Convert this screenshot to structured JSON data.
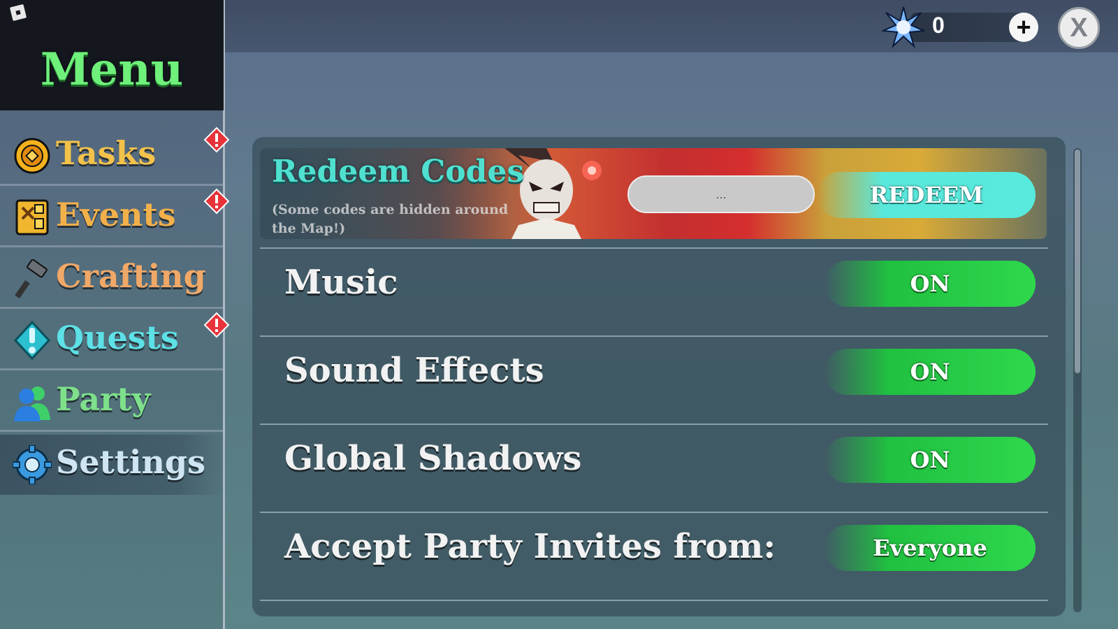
{
  "menu": {
    "title": "Menu",
    "items": [
      {
        "label": "Tasks",
        "color": "#f2c24a",
        "icon": "coin-icon",
        "alert": true
      },
      {
        "label": "Events",
        "color": "#f2b04a",
        "icon": "scroll-icon",
        "alert": true
      },
      {
        "label": "Crafting",
        "color": "#f0a868",
        "icon": "hammer-icon",
        "alert": false
      },
      {
        "label": "Quests",
        "color": "#5de0e6",
        "icon": "quest-marker-icon",
        "alert": true
      },
      {
        "label": "Party",
        "color": "#7ee08a",
        "icon": "party-icon",
        "alert": false
      },
      {
        "label": "Settings",
        "color": "#cfe6f2",
        "icon": "gear-icon",
        "alert": false,
        "active": true
      }
    ]
  },
  "currency": {
    "value": "0",
    "icon": "star-burst-icon",
    "add_label": "+"
  },
  "close_label": "X",
  "redeem": {
    "title": "Redeem Codes",
    "subtitle": "(Some codes are hidden around the Map!)",
    "input_placeholder": "...",
    "button_label": "REDEEM"
  },
  "settings": [
    {
      "label": "Music",
      "value": "ON"
    },
    {
      "label": "Sound Effects",
      "value": "ON"
    },
    {
      "label": "Global Shadows",
      "value": "ON"
    },
    {
      "label": "Accept Party Invites from:",
      "value": "Everyone"
    }
  ],
  "colors": {
    "menu_title": "#6ef07a",
    "redeem_title": "#4fe0d0",
    "toggle_green": "#2ed84c",
    "redeem_cyan": "#58eadc",
    "alert_red": "#e8333a"
  }
}
